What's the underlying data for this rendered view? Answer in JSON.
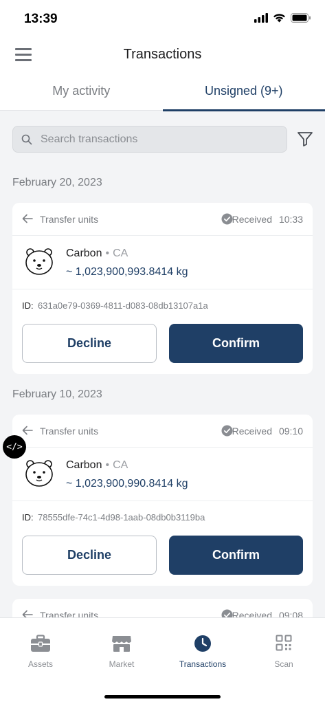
{
  "status_bar": {
    "time": "13:39"
  },
  "header": {
    "title": "Transactions",
    "tabs": [
      {
        "label": "My activity",
        "active": false
      },
      {
        "label": "Unsigned (9+)",
        "active": true
      }
    ]
  },
  "search": {
    "placeholder": "Search transactions"
  },
  "groups": [
    {
      "date": "February 20, 2023",
      "card": {
        "type": "Transfer units",
        "status": "Received",
        "time": "10:33",
        "asset": "Carbon",
        "region": "CA",
        "amount": "~ 1,023,900,993.8414 kg",
        "id_label": "ID:",
        "id": "631a0e79-0369-4811-d083-08db13107a1a",
        "decline_label": "Decline",
        "confirm_label": "Confirm"
      }
    },
    {
      "date": "February 10, 2023",
      "card": {
        "type": "Transfer units",
        "status": "Received",
        "time": "09:10",
        "asset": "Carbon",
        "region": "CA",
        "amount": "~ 1,023,900,990.8414 kg",
        "id_label": "ID:",
        "id": "78555dfe-74c1-4d98-1aab-08db0b3119ba",
        "decline_label": "Decline",
        "confirm_label": "Confirm"
      }
    },
    {
      "card": {
        "type": "Transfer units",
        "status": "Received",
        "time": "09:08"
      }
    }
  ],
  "dev_badge": "</>",
  "bottom_nav": [
    {
      "label": "Assets",
      "icon": "briefcase-icon",
      "active": false
    },
    {
      "label": "Market",
      "icon": "store-icon",
      "active": false
    },
    {
      "label": "Transactions",
      "icon": "clock-icon",
      "active": true
    },
    {
      "label": "Scan",
      "icon": "qr-code-icon",
      "active": false
    }
  ],
  "colors": {
    "primary": "#1f3f66",
    "muted": "#7a7d82",
    "background": "#f3f4f6"
  }
}
